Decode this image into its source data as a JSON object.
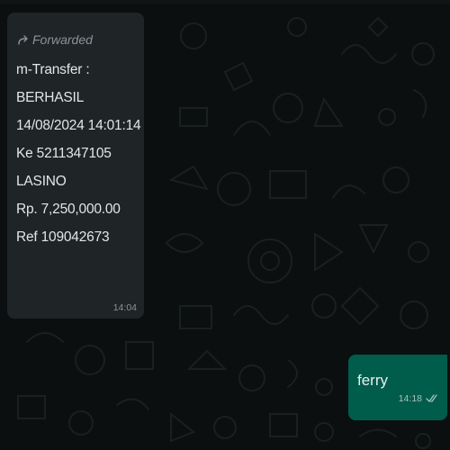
{
  "incoming_message": {
    "forwarded_label": "Forwarded",
    "lines": [
      "m-Transfer :",
      "BERHASIL",
      "14/08/2024 14:01:14",
      "Ke 5211347105",
      "LASINO",
      "Rp. 7,250,000.00",
      "Ref 109042673"
    ],
    "time": "14:04",
    "forwarded_icon": "forward-arrow-icon"
  },
  "outgoing_message": {
    "text": "ferry",
    "time": "14:18",
    "status_icon": "double-check-icon"
  },
  "colors": {
    "chat_background": "#0c0f0f",
    "incoming_bubble": "#1f2426",
    "outgoing_bubble": "#005c4b",
    "text_primary": "#e3e6e8",
    "text_muted": "#8a9499"
  }
}
